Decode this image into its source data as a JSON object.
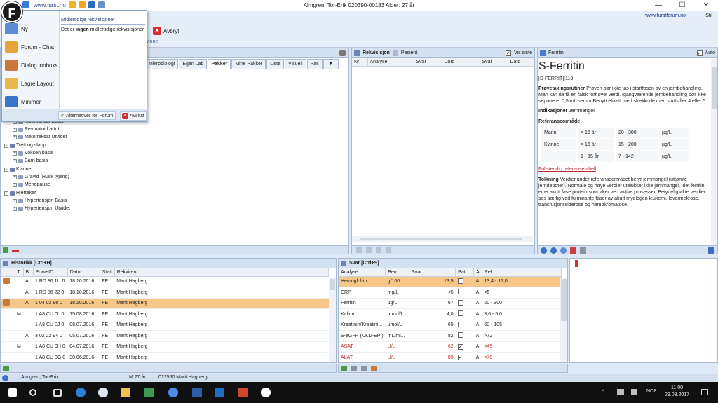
{
  "window": {
    "title": "Almgren, Tor-Erik  020390-00183 Alder: 27 år",
    "url": "www.furst.no",
    "forum_link": "www.furstforum.no",
    "style_label": "Stil",
    "minimize": "—",
    "maximize": "☐",
    "close": "✕"
  },
  "ribbon": {
    "avbryt": "Avbryt",
    "group_label": "kvinne"
  },
  "app_menu": {
    "badge": "F",
    "items": [
      {
        "label": "Ny",
        "icon": "document-list-icon"
      },
      {
        "label": "Forum - Chat",
        "icon": "users-chat-icon"
      },
      {
        "label": "Dialog innboks",
        "icon": "users-inbox-icon"
      },
      {
        "label": "Lagre Layout",
        "icon": "folder-save-icon"
      },
      {
        "label": "Minimer",
        "icon": "arrow-down-icon"
      }
    ],
    "right_header": "Midlertidige rekvisisjoner",
    "right_body_pre": "Det er ",
    "right_body_bold": "ingen",
    "right_body_post": " midlertidige rekvisisjoner",
    "forum_options": "Alternativer for Forum",
    "exit": "Avslutt"
  },
  "tabs": [
    "Mikrobiologi",
    "Egen Lab",
    "Pakker",
    "Mine Pakker",
    "Liste",
    "Visuell",
    "Pas"
  ],
  "active_tab": "Pakker",
  "tree": [
    {
      "label": "Metotreksat Basis",
      "level": 2
    },
    {
      "label": "Revmatoid artritt",
      "level": 2
    },
    {
      "label": "Metotreksat Utvidet",
      "level": 2
    },
    {
      "label": "Trett og slapp",
      "level": 1
    },
    {
      "label": "Voksen basis",
      "level": 2
    },
    {
      "label": "Barn basis",
      "level": 2
    },
    {
      "label": "Kvinne",
      "level": 1
    },
    {
      "label": "Gravid (Husk typing)",
      "level": 2
    },
    {
      "label": "Menopause",
      "level": 2
    },
    {
      "label": "Hjertekar",
      "level": 1
    },
    {
      "label": "Hypertensjon Basis",
      "level": 2
    },
    {
      "label": "Hypertensjon Utvidet",
      "level": 2
    }
  ],
  "rekvisisjon": {
    "tab1": "Rekvisisjon",
    "tab2": "Pasient",
    "vis_siste": "Vis siste",
    "columns": [
      "Nr",
      "Analyse",
      "Svar",
      "Dato",
      "Svar",
      "Dato"
    ]
  },
  "info": {
    "header": "Ferritin",
    "auto": "Auto",
    "title": "S-Ferritin",
    "code": "[S-FERRIT][119]",
    "prove_label": "Prøvetakingsrutiner",
    "prove_text": " Prøven bør ikke tas i startfasen av en jernbehandling. Man kan da få en falsk forhøyet verdi. Igangværende jernbehandling bør ikke seponere. 0,5 mL serum Benytt etikett med strekkode med sluttsiffer 4 eller 5.",
    "ind_label": "Indikasjoner",
    "ind_text": " Jernmangel.",
    "ref_label": "Referanseområde",
    "ref_rows": [
      [
        "Mann",
        "> 16 år",
        "20 - 300",
        "µg/L"
      ],
      [
        "Kvinne",
        "> 16 år",
        "15 - 200",
        "µg/L"
      ],
      [
        "",
        "1 - 15 år",
        "7 - 142",
        "µg/L"
      ]
    ],
    "full_ref_link": "Fullstendig referansetabell",
    "tolk_label": "Tolkning",
    "tolk_text": " Verdier under referanseområdet betyr jernmangel (uttømte jerndepoter). Normale og høye verdier utelukker ikke jernmangel, idet ferritin er et akutt fase protein som øker ved aktive prosesser. Betydelig økte verdier ses særlig ved fulminante faser av akutt myelogen leukemi, levermekrose, transfusjonssiderose og hemokromatose."
  },
  "historikk": {
    "header": "Historikk [Ctrl+H]",
    "columns": [
      "T",
      "B",
      "PrøveID",
      "Dato",
      "Stati",
      "Rekvirent"
    ],
    "rows": [
      {
        "t": "",
        "b": "A",
        "id": "1 RD 86 1U 0",
        "dato": "18.10.2016",
        "stat": "FE",
        "rek": "Marit Hagberg",
        "icon": true,
        "sel": false
      },
      {
        "t": "",
        "b": "A",
        "id": "1 RD 86 22 0",
        "dato": "18.10.2016",
        "stat": "FE",
        "rek": "Marit Hagberg",
        "icon": false,
        "sel": false
      },
      {
        "t": "",
        "b": "A",
        "id": "1 04 02 88 0",
        "dato": "18.10.2016",
        "stat": "FE",
        "rek": "Marit Hagberg",
        "icon": true,
        "sel": true
      },
      {
        "t": "M",
        "b": "",
        "id": "1 A8 CU 0L 0",
        "dato": "15.08.2016",
        "stat": "FE",
        "rek": "Marit Hagberg",
        "icon": false,
        "sel": false
      },
      {
        "t": "",
        "b": "",
        "id": "1 A8 CU 0J 0",
        "dato": "08.07.2016",
        "stat": "FE",
        "rek": "Marit Hagberg",
        "icon": false,
        "sel": false
      },
      {
        "t": "",
        "b": "A",
        "id": "3 02 22 94 0",
        "dato": "05.07.2016",
        "stat": "FE",
        "rek": "Marit Hagberg",
        "icon": false,
        "sel": false
      },
      {
        "t": "M",
        "b": "",
        "id": "1 A8 CU 0H 0",
        "dato": "04.07.2016",
        "stat": "FE",
        "rek": "Marit Hagberg",
        "icon": false,
        "sel": false
      },
      {
        "t": "",
        "b": "",
        "id": "1 A8 CU 0G 0",
        "dato": "30.06.2016",
        "stat": "FE",
        "rek": "Marit Hagberg",
        "icon": false,
        "sel": false
      }
    ]
  },
  "svar": {
    "header": "Svar [Ctrl+S]",
    "columns": [
      "Analyse",
      "Ben.",
      "Svar",
      "Pat",
      "A",
      "Ref"
    ],
    "rows": [
      {
        "analyse": "Hemoglobin",
        "ben": "g/100 ...",
        "svar": "13,5",
        "pat": false,
        "a": "A",
        "ref": "13,4 - 17,0",
        "red": false,
        "sel": true
      },
      {
        "analyse": "CRP",
        "ben": "mg/L",
        "svar": "<5",
        "pat": false,
        "a": "A",
        "ref": "<5",
        "red": false,
        "sel": false
      },
      {
        "analyse": "Ferritin",
        "ben": "ug/L",
        "svar": "67",
        "pat": false,
        "a": "A",
        "ref": "20 - 300",
        "red": false,
        "sel": false
      },
      {
        "analyse": "Kalium",
        "ben": "mmol/L",
        "svar": "4,0",
        "pat": false,
        "a": "A",
        "ref": "3,6 - 5,0",
        "red": false,
        "sel": false
      },
      {
        "analyse": "Kreatinin/Kreatini...",
        "ben": "umol/L",
        "svar": "65",
        "pat": false,
        "a": "A",
        "ref": "60 - 105",
        "red": false,
        "sel": false
      },
      {
        "analyse": "S-eGFR (CKD-EPI)",
        "ben": "mL/mi...",
        "svar": "82",
        "pat": false,
        "a": "A",
        "ref": ">72",
        "red": false,
        "sel": false
      },
      {
        "analyse": "ASAT",
        "ben": "U/L",
        "svar": "62",
        "pat": true,
        "a": "A",
        "ref": "<45",
        "red": true,
        "sel": false
      },
      {
        "analyse": "ALAT",
        "ben": "U/L",
        "svar": "89",
        "pat": true,
        "a": "A",
        "ref": "<70",
        "red": true,
        "sel": false
      }
    ]
  },
  "statusbar": {
    "patient": "Almgren, Tor-Erik",
    "gender_age": "M   27 år",
    "doctor": "012550 Marit Hagberg"
  },
  "taskbar": {
    "lang": "NO8",
    "time": "11:00",
    "date": "29.03.2017"
  }
}
